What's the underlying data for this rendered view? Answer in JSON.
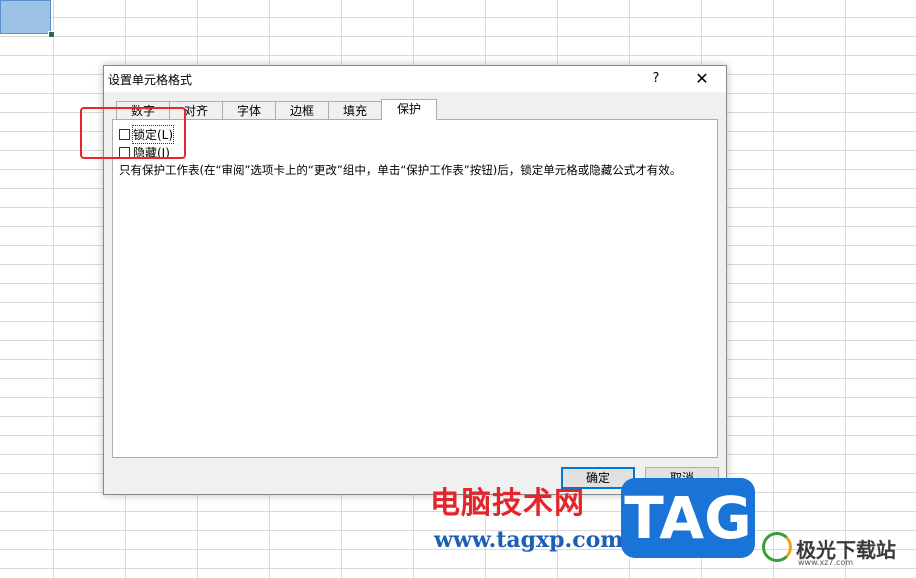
{
  "dialog": {
    "title": "设置单元格格式",
    "help_label": "?",
    "close_label": "✕",
    "tabs": [
      {
        "label": "数字"
      },
      {
        "label": "对齐"
      },
      {
        "label": "字体"
      },
      {
        "label": "边框"
      },
      {
        "label": "填充"
      },
      {
        "label": "保护"
      }
    ],
    "active_tab": "保护",
    "protection": {
      "locked_label": "锁定(L)",
      "locked_checked": false,
      "hidden_label": "隐藏(I)",
      "hidden_checked": false,
      "description": "只有保护工作表(在“审阅”选项卡上的“更改”组中，单击“保护工作表”按钮)后，锁定单元格或隐藏公式才有效。"
    },
    "ok_label": "确定",
    "cancel_label": "取消"
  },
  "watermark": {
    "site_name": "电脑技术网",
    "url": "www.tagxp.com",
    "tag": "TAG",
    "logo_name": "极光下载站",
    "logo_url": "www.xz7.com"
  },
  "colors": {
    "highlight": "#e8262d",
    "selection_fill": "#9cc3e5",
    "tag_blue": "#1a73d6"
  }
}
